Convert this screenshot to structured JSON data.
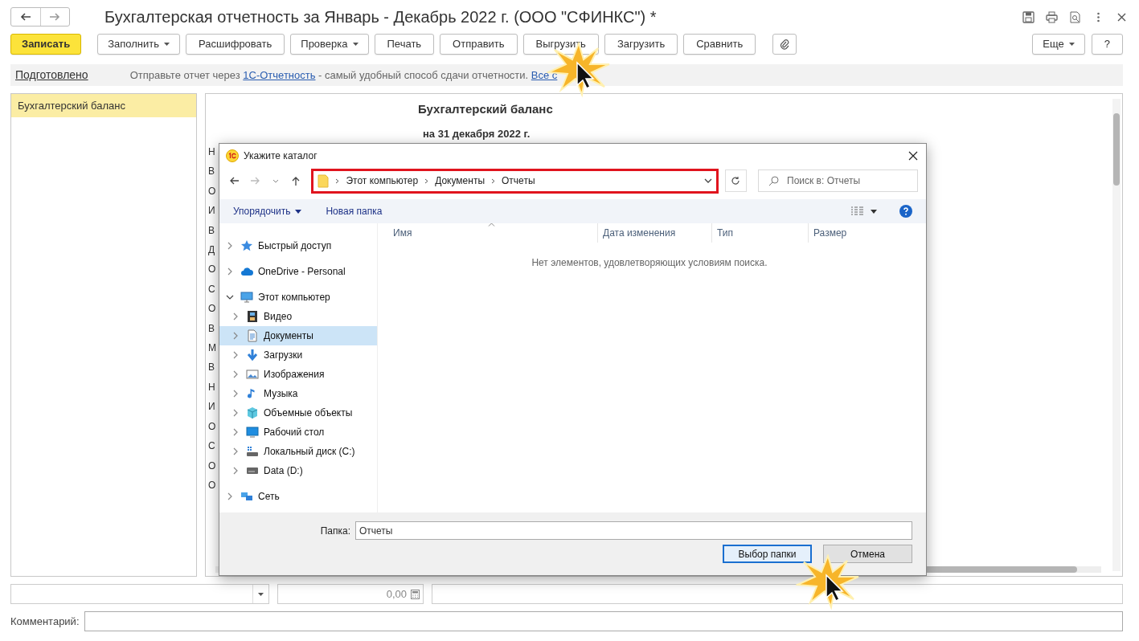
{
  "window": {
    "title": "Бухгалтерская отчетность за Январь - Декабрь 2022 г. (ООО \"СФИНКС\") *"
  },
  "toolbar": {
    "buttons": [
      {
        "label": "Записать",
        "kind": "primary"
      },
      {
        "label": "Заполнить",
        "kind": "dropdown"
      },
      {
        "label": "Расшифровать",
        "kind": "plain"
      },
      {
        "label": "Проверка",
        "kind": "dropdown"
      },
      {
        "label": "Печать",
        "kind": "plain"
      },
      {
        "label": "Отправить",
        "kind": "plain"
      },
      {
        "label": "Выгрузить",
        "kind": "plain"
      },
      {
        "label": "Загрузить",
        "kind": "plain"
      },
      {
        "label": "Сравнить",
        "kind": "plain"
      }
    ],
    "right_buttons": [
      {
        "label": "Еще",
        "kind": "dropdown"
      },
      {
        "label": "?",
        "kind": "plain"
      }
    ]
  },
  "info_bar": {
    "status": "Подготовлено",
    "text_before": "Отправьте отчет через",
    "link": "1С-Отчетность",
    "text_after": "- самый удобный способ сдачи отчетности.",
    "more_link": "Все с"
  },
  "sidebar": {
    "items": [
      {
        "label": "Бухгалтерский баланс",
        "selected": true
      }
    ]
  },
  "document": {
    "title": "Бухгалтерский баланс",
    "subtitle": "на 31 декабря 2022 г.",
    "fragments": [
      "Н",
      "В",
      "О",
      "И",
      "В",
      "Д",
      "О",
      "С",
      "О",
      "В",
      "М",
      "В",
      "Н",
      "И",
      "О",
      "С",
      "О",
      "О"
    ]
  },
  "dialog": {
    "title": "Укажите каталог",
    "path": [
      "Этот компьютер",
      "Документы",
      "Отчеты"
    ],
    "search": {
      "placeholder": "Поиск в: Отчеты"
    },
    "commands": [
      "Упорядочить",
      "Новая папка"
    ],
    "tree": [
      {
        "label": "Быстрый доступ",
        "kind": "star",
        "expanded": false,
        "selected": false
      },
      {
        "label": "OneDrive - Personal",
        "kind": "cloud",
        "expanded": false,
        "selected": false
      },
      {
        "label": "Этот компьютер",
        "kind": "computer",
        "expanded": true,
        "selected": false,
        "children": [
          {
            "label": "Видео",
            "kind": "video",
            "expanded": false,
            "selected": false
          },
          {
            "label": "Документы",
            "kind": "document",
            "expanded": false,
            "selected": true
          },
          {
            "label": "Загрузки",
            "kind": "download",
            "expanded": false,
            "selected": false
          },
          {
            "label": "Изображения",
            "kind": "image",
            "expanded": false,
            "selected": false
          },
          {
            "label": "Музыка",
            "kind": "music",
            "expanded": false,
            "selected": false
          },
          {
            "label": "Объемные объекты",
            "kind": "cube",
            "expanded": false,
            "selected": false
          },
          {
            "label": "Рабочий стол",
            "kind": "desktop",
            "expanded": false,
            "selected": false
          },
          {
            "label": "Локальный диск (C:)",
            "kind": "system-drive",
            "expanded": false,
            "selected": false
          },
          {
            "label": "Data (D:)",
            "kind": "drive",
            "expanded": false,
            "selected": false
          }
        ]
      },
      {
        "label": "Сеть",
        "kind": "network",
        "expanded": false,
        "selected": false
      }
    ],
    "columns": [
      "Имя",
      "Дата изменения",
      "Тип",
      "Размер"
    ],
    "empty_message": "Нет элементов, удовлетворяющих условиям поиска.",
    "folder_label": "Папка:",
    "folder_value": "Отчеты",
    "buttons": [
      {
        "label": "Выбор папки",
        "kind": "default"
      },
      {
        "label": "Отмена",
        "kind": "plain"
      }
    ]
  },
  "footer": {
    "amount": "0,00",
    "comment_label": "Комментарий:"
  }
}
